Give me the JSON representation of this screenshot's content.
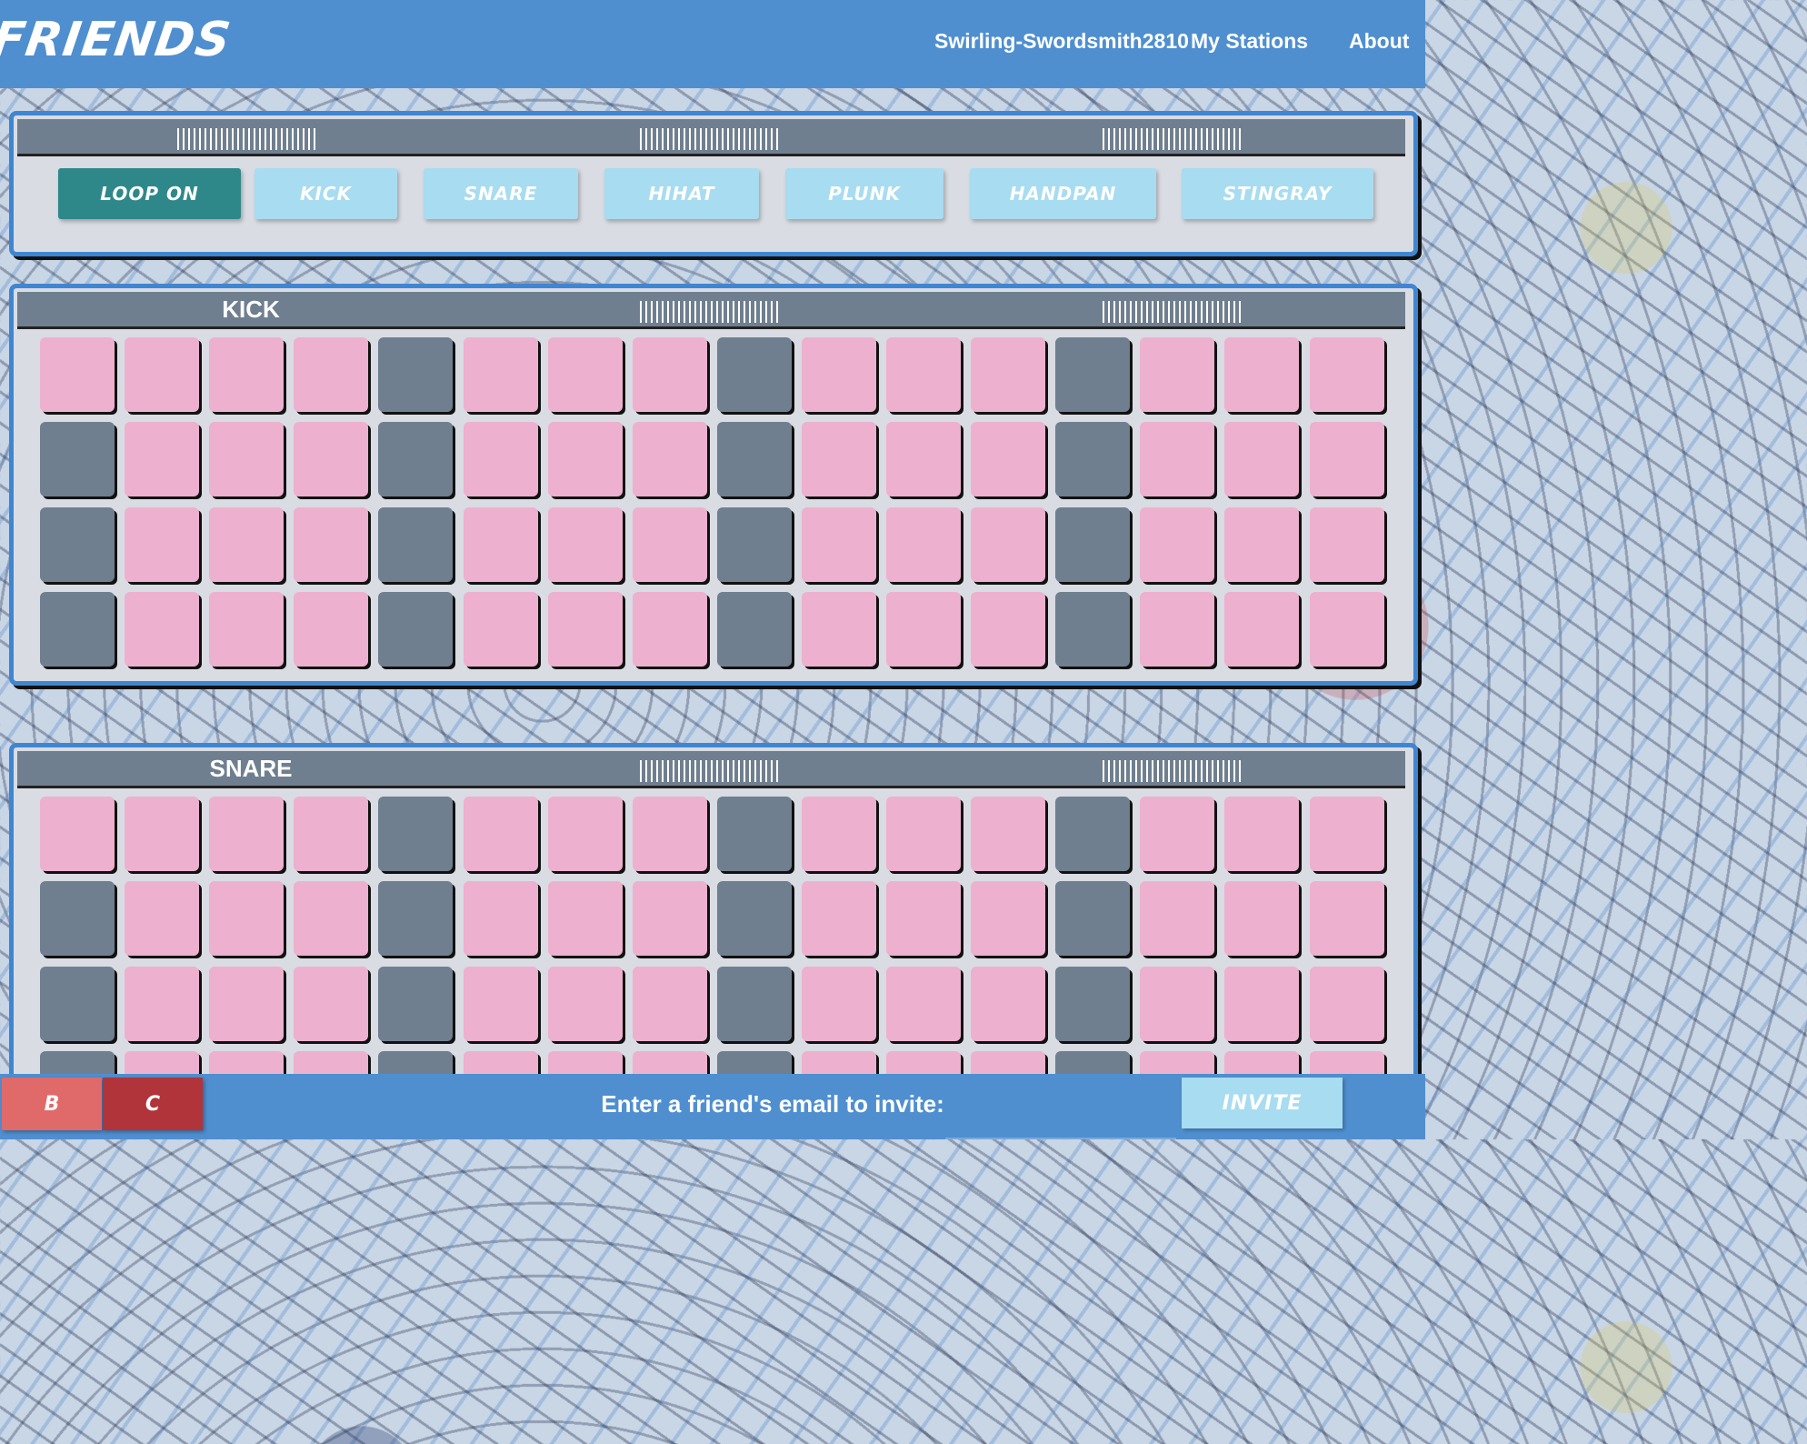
{
  "header": {
    "logo": "FRIENDS",
    "username": "Swirling-Swordsmith2810",
    "nav_my_stations": "My Stations",
    "nav_about": "About"
  },
  "instruments": {
    "loop_label": "LOOP ON",
    "buttons": [
      "KICK",
      "SNARE",
      "HIHAT",
      "PLUNK",
      "HANDPAN",
      "STINGRAY"
    ]
  },
  "tracks": [
    {
      "name": "KICK",
      "active_steps": [
        [
          4,
          8,
          12
        ],
        [
          0,
          4,
          8,
          12
        ],
        [
          0,
          4,
          8,
          12
        ],
        [
          0,
          4,
          8,
          12
        ]
      ]
    },
    {
      "name": "SNARE",
      "active_steps": [
        [
          4,
          8,
          12
        ],
        [
          0,
          4,
          8,
          12
        ],
        [
          0,
          4,
          8,
          12
        ],
        [
          0,
          4,
          8,
          12
        ]
      ]
    }
  ],
  "steps_per_row": 16,
  "footer": {
    "key_b": "B",
    "key_c": "C",
    "invite_prompt": "Enter a friend's email to invite:",
    "invite_placeholder": "",
    "invite_button": "INVITE"
  },
  "colors": {
    "primary": "#4f8fd0",
    "cell_off": "#eeb0cf",
    "cell_on": "#6f7f8f",
    "loop_on": "#2e888a",
    "instrument_button": "#a8dcf0",
    "key_b": "#e06a6a",
    "key_c": "#b0343a"
  }
}
